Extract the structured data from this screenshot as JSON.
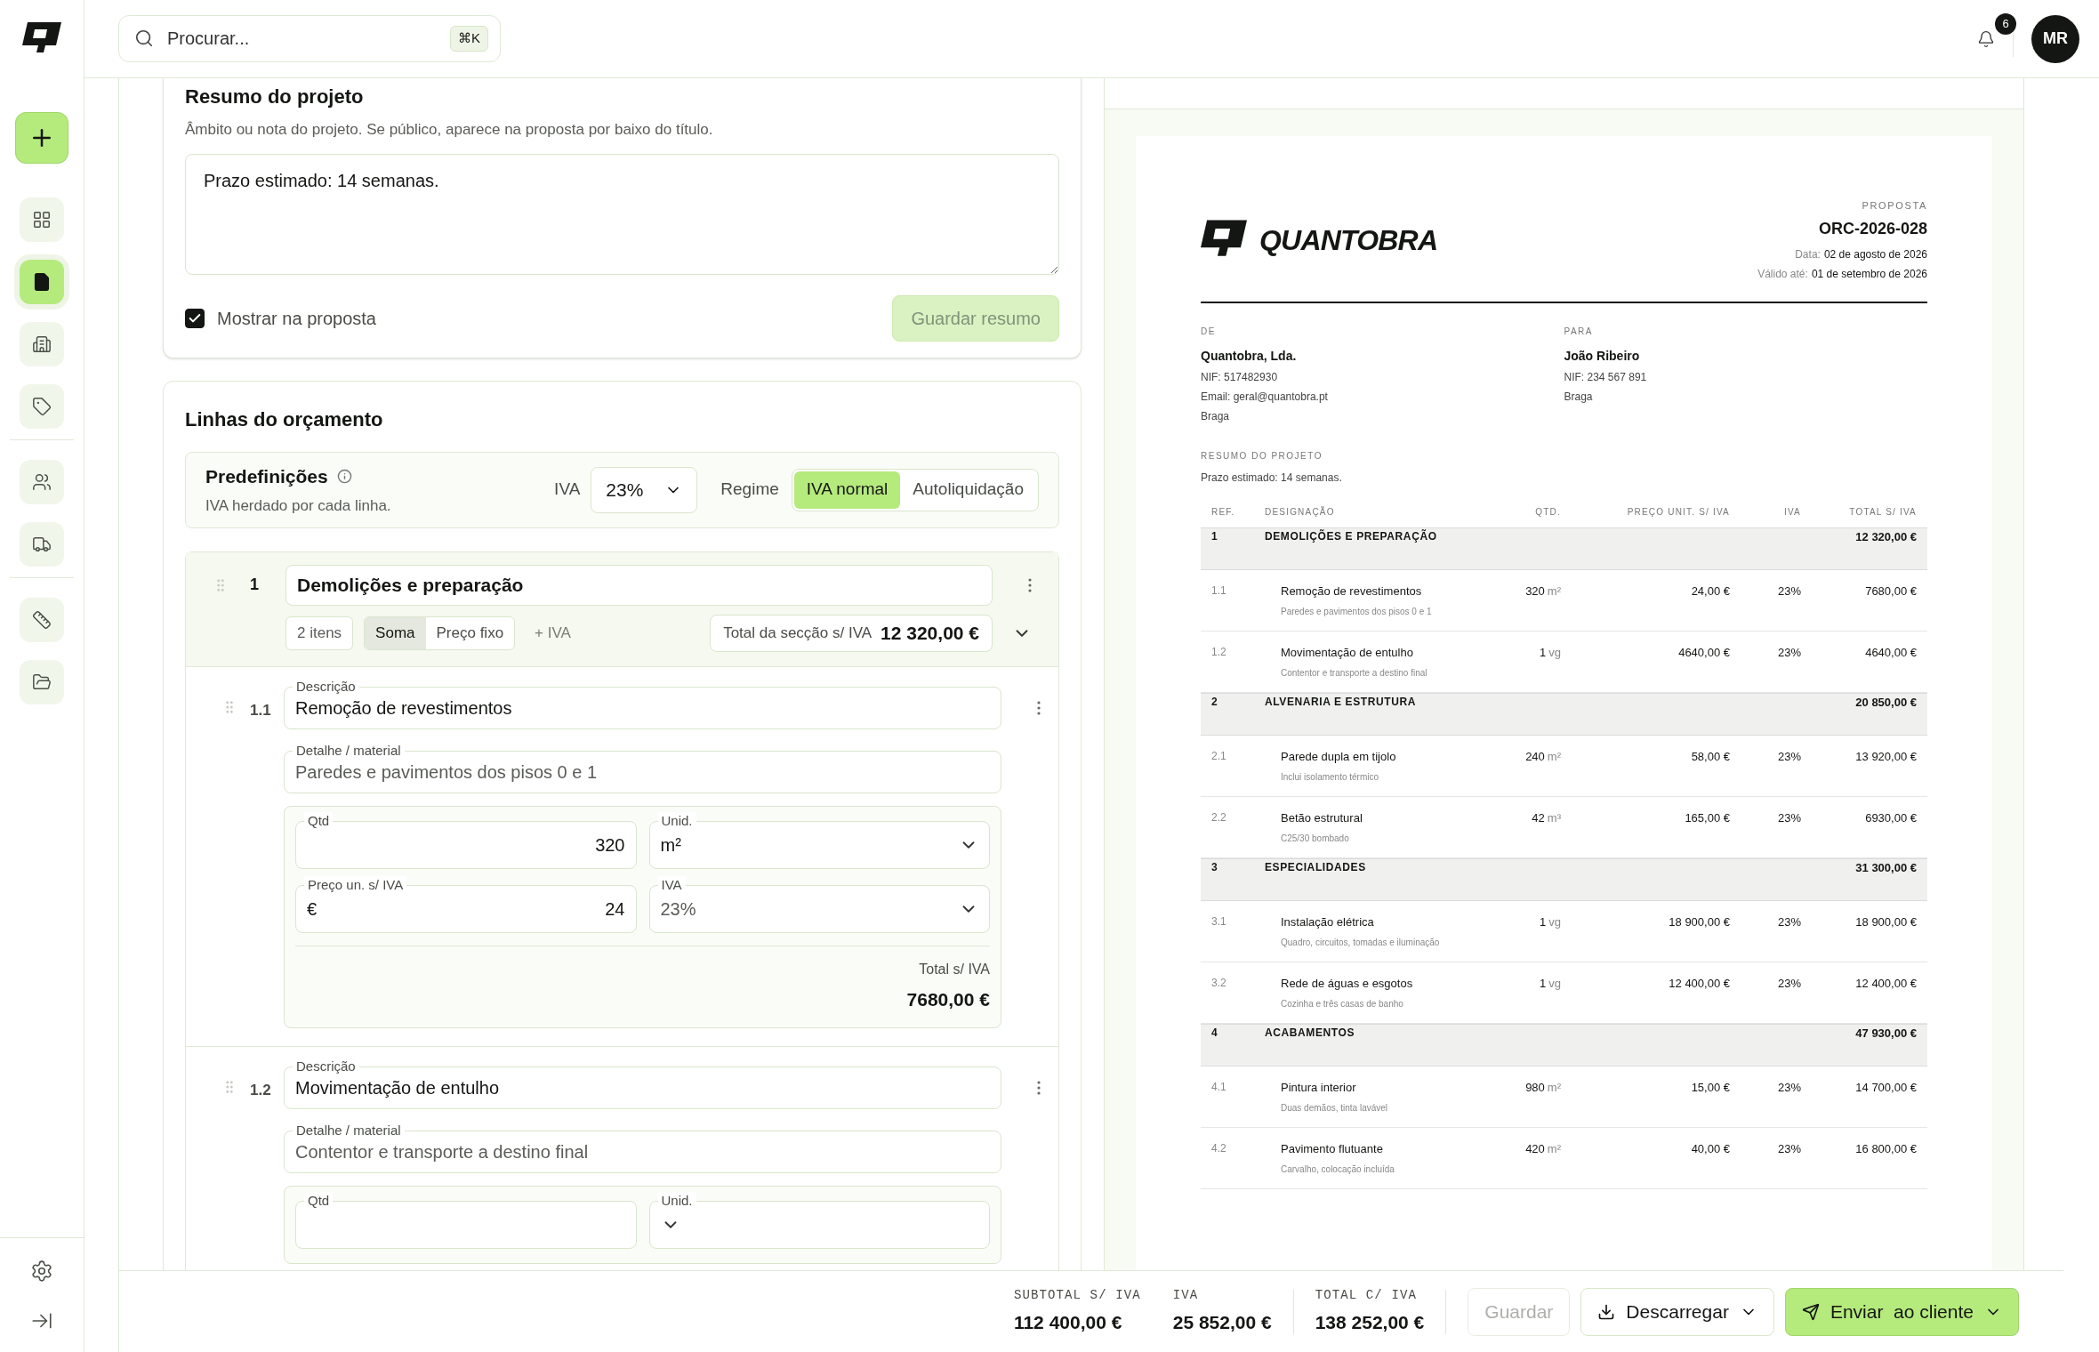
{
  "sidebar": {
    "add_button": {
      "selected": false
    },
    "nav_groups": [
      [
        {
          "selected": false
        },
        {
          "selected": true
        },
        {
          "selected": false
        },
        {
          "selected": false
        }
      ],
      [
        {
          "selected": false
        },
        {
          "selected": false
        }
      ],
      [
        {
          "selected": false
        },
        {
          "selected": false
        }
      ]
    ]
  },
  "header": {
    "search": {
      "placeholder": "Procurar...",
      "shortcut": "⌘K"
    },
    "notifications": "6",
    "avatar": "MR"
  },
  "summary_card": {
    "title": "Resumo do projeto",
    "hint": "Âmbito ou nota do projeto. Se público, aparece na proposta por baixo do título.",
    "value": "Prazo estimado: 14 semanas.",
    "checkbox": {
      "label": "Mostrar na proposta",
      "checked": true
    },
    "save_button": {
      "label": "Guardar resumo",
      "disabled": true
    }
  },
  "lines_card": {
    "title": "Linhas do orçamento",
    "presets": {
      "title": "Predefinições",
      "subtitle": "IVA herdado por cada linha.",
      "iva_label": "IVA",
      "iva_value": "23%",
      "regime_label": "Regime",
      "regime_options": [
        {
          "label": "IVA normal",
          "selected": true
        },
        {
          "label": "Autoliquidação",
          "selected": false
        }
      ]
    },
    "section": {
      "number": "1",
      "title": "Demolições e preparação",
      "item_count": "2 itens",
      "modes": [
        {
          "label": "Soma",
          "selected": true
        },
        {
          "label": "Preço fixo",
          "selected": false
        }
      ],
      "vat_note": "+ IVA",
      "total_label": "Total da secção s/ IVA",
      "total": "12 320,00 €",
      "expanded": true,
      "items": [
        {
          "ref": "1.1",
          "description_label": "Descrição",
          "description": "Remoção de revestimentos",
          "detail_label": "Detalhe / material",
          "detail": "Paredes e pavimentos dos pisos 0 e 1",
          "qty_label": "Qtd",
          "qty": "320",
          "unit_label": "Unid.",
          "unit": "m²",
          "price_label": "Preço un. s/ IVA",
          "currency": "€",
          "price": "24",
          "vat_label": "IVA",
          "vat": "23%",
          "total_label": "Total s/ IVA",
          "total": "7680,00 €"
        },
        {
          "ref": "1.2",
          "description_label": "Descrição",
          "description": "Movimentação de entulho",
          "detail_label": "Detalhe / material",
          "detail": "Contentor e transporte a destino final",
          "qty_label": "Qtd",
          "unit_label": "Unid."
        }
      ]
    }
  },
  "document": {
    "brand": "QUANTOBRA",
    "doc_type": "PROPOSTA",
    "number": "ORC-2026-028",
    "date_label": "Data:",
    "date": "02 de agosto de 2026",
    "valid_label": "Válido até:",
    "valid": "01 de setembro de 2026",
    "from": {
      "label": "DE",
      "name": "Quantobra, Lda.",
      "lines": [
        "NIF: 517482930",
        "Email: geral@quantobra.pt",
        "Braga"
      ]
    },
    "to": {
      "label": "PARA",
      "name": "João Ribeiro",
      "lines": [
        "NIF: 234 567 891",
        "Braga"
      ]
    },
    "summary_label": "RESUMO DO PROJETO",
    "summary": "Prazo estimado: 14 semanas.",
    "columns": [
      "REF.",
      "DESIGNAÇÃO",
      "QTD.",
      "PREÇO UNIT. S/ IVA",
      "IVA",
      "TOTAL S/ IVA"
    ],
    "sections": [
      {
        "ref": "1",
        "title": "DEMOLIÇÕES E PREPARAÇÃO",
        "total": "12 320,00 €",
        "rows": [
          {
            "ref": "1.1",
            "name": "Remoção de revestimentos",
            "detail": "Paredes e pavimentos dos pisos 0 e 1",
            "qty": "320",
            "unit": "m²",
            "price": "24,00 €",
            "vat": "23%",
            "total": "7680,00 €"
          },
          {
            "ref": "1.2",
            "name": "Movimentação de entulho",
            "detail": "Contentor e transporte a destino final",
            "qty": "1",
            "unit": "vg",
            "price": "4640,00 €",
            "vat": "23%",
            "total": "4640,00 €"
          }
        ]
      },
      {
        "ref": "2",
        "title": "ALVENARIA E ESTRUTURA",
        "total": "20 850,00 €",
        "rows": [
          {
            "ref": "2.1",
            "name": "Parede dupla em tijolo",
            "detail": "Inclui isolamento térmico",
            "qty": "240",
            "unit": "m²",
            "price": "58,00 €",
            "vat": "23%",
            "total": "13 920,00 €"
          },
          {
            "ref": "2.2",
            "name": "Betão estrutural",
            "detail": "C25/30 bombado",
            "qty": "42",
            "unit": "m³",
            "price": "165,00 €",
            "vat": "23%",
            "total": "6930,00 €"
          }
        ]
      },
      {
        "ref": "3",
        "title": "ESPECIALIDADES",
        "total": "31 300,00 €",
        "rows": [
          {
            "ref": "3.1",
            "name": "Instalação elétrica",
            "detail": "Quadro, circuitos, tomadas e iluminação",
            "qty": "1",
            "unit": "vg",
            "price": "18 900,00 €",
            "vat": "23%",
            "total": "18 900,00 €"
          },
          {
            "ref": "3.2",
            "name": "Rede de águas e esgotos",
            "detail": "Cozinha e três casas de banho",
            "qty": "1",
            "unit": "vg",
            "price": "12 400,00 €",
            "vat": "23%",
            "total": "12 400,00 €"
          }
        ]
      },
      {
        "ref": "4",
        "title": "ACABAMENTOS",
        "total": "47 930,00 €",
        "rows": [
          {
            "ref": "4.1",
            "name": "Pintura interior",
            "detail": "Duas demãos, tinta lavável",
            "qty": "980",
            "unit": "m²",
            "price": "15,00 €",
            "vat": "23%",
            "total": "14 700,00 €"
          },
          {
            "ref": "4.2",
            "name": "Pavimento flutuante",
            "detail": "Carvalho, colocação incluída",
            "qty": "420",
            "unit": "m²",
            "price": "40,00 €",
            "vat": "23%",
            "total": "16 800,00 €"
          }
        ]
      }
    ]
  },
  "footer": {
    "totals": [
      [
        {
          "label": "SUBTOTAL S/ IVA",
          "value": "112 400,00 €"
        },
        {
          "label": "IVA",
          "value": "25 852,00 €"
        }
      ],
      [
        {
          "label": "TOTAL C/ IVA",
          "value": "138 252,00 €"
        }
      ]
    ],
    "buttons": [
      {
        "kind": "plain",
        "label": "Guardar",
        "disabled": true
      },
      {
        "kind": "download",
        "label": "Descarregar",
        "disabled": false
      },
      {
        "kind": "send",
        "label": "Enviar  ao cliente",
        "disabled": false
      }
    ]
  }
}
